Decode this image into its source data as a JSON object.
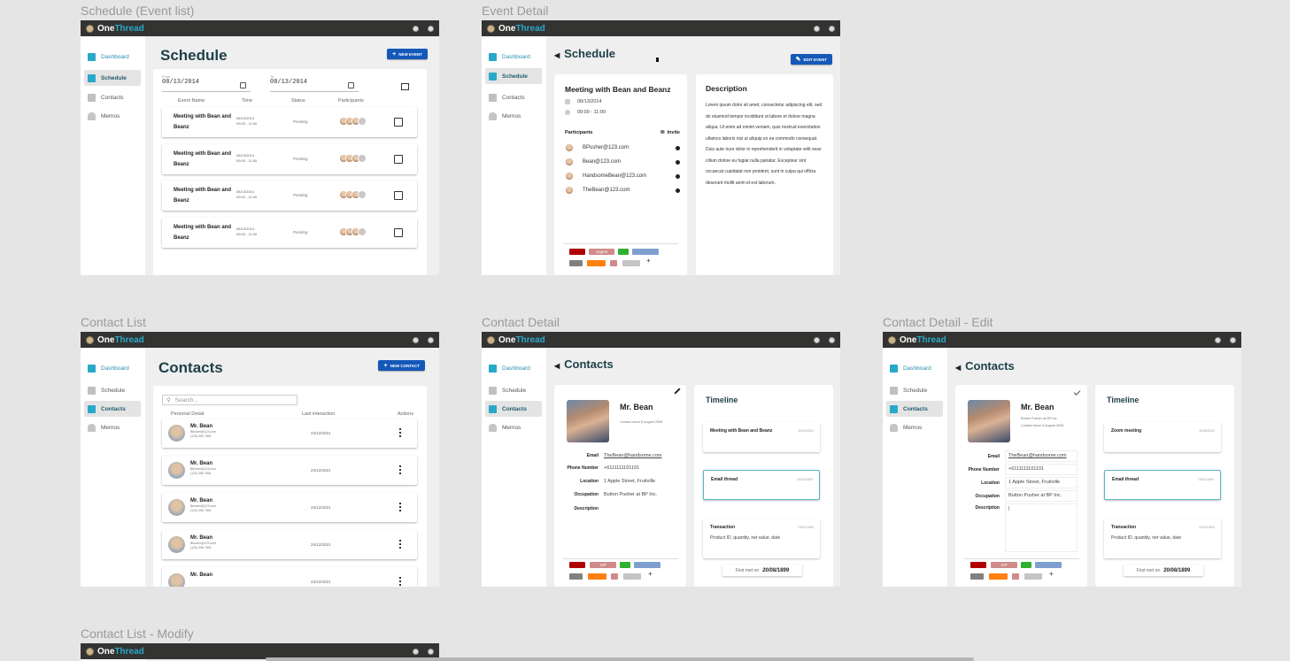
{
  "app": {
    "brand_part1": "One",
    "brand_part2": "Thread"
  },
  "sidebar": {
    "items": [
      {
        "label": "Dashboard",
        "icon": "dashboard-icon"
      },
      {
        "label": "Schedule",
        "icon": "calendar-icon"
      },
      {
        "label": "Contacts",
        "icon": "contact-card-icon"
      },
      {
        "label": "Memos",
        "icon": "bell-icon"
      }
    ]
  },
  "frames": {
    "schedule": {
      "label": "Schedule (Event list)",
      "title": "Schedule",
      "new_button": "NEW EVENT",
      "from_label": "From",
      "from_value": "08/13/2014",
      "to_label": "To",
      "to_value": "08/13/2014",
      "columns": [
        "Event Name",
        "Time",
        "Status",
        "Participants"
      ],
      "events": [
        {
          "name": "Meeting with Bean and Beanz",
          "date": "08/13/2014",
          "time": "09:00 - 11:00",
          "status": "Pending"
        },
        {
          "name": "Meeting with Bean and Beanz",
          "date": "08/13/2014",
          "time": "09:00 - 11:00",
          "status": "Pending"
        },
        {
          "name": "Meeting with Bean and Beanz",
          "date": "08/13/2014",
          "time": "09:00 - 11:00",
          "status": "Pending"
        },
        {
          "name": "Meeting with Bean and Beanz",
          "date": "08/13/2014",
          "time": "09:00 - 11:00",
          "status": "Pending"
        }
      ]
    },
    "event_detail": {
      "label": "Event Detail",
      "back_title": "Schedule",
      "edit_button": "EDIT EVENT",
      "event_title": "Meeting with Bean and Beanz",
      "date": "08/13/2014",
      "time": "09:00 - 11:00",
      "participants_label": "Participants",
      "invite_label": "Invite",
      "participants": [
        "BPusher@123.com",
        "Bean@123.com",
        "HandsomeBean@123.com",
        "TheBean@123.com"
      ],
      "description_title": "Description",
      "description": "Lorem ipsum dolor sit amet, consectetur adipiscing elit, sed do eiusmod tempor incididunt ut labore et dolore magna aliqua. Ut enim ad minim veniam, quis nostrud exercitation ullamco laboris nisi ut aliquip ex ea commodo consequat. Duis aute irure dolor in reprehenderit in voluptate velit esse cillum dolore eu fugiat nulla pariatur. Excepteur sint occaecat cupidatat non proident, sunt in culpa qui officia deserunt mollit anim id est laborum.",
      "tags": [
        {
          "label": "",
          "color": "#b00000"
        },
        {
          "label": "Urgent",
          "color": "#d08a8a"
        },
        {
          "label": "",
          "color": "#30b030"
        },
        {
          "label": "",
          "color": "#7fa0cf"
        },
        {
          "label": "",
          "color": "#808080"
        },
        {
          "label": "",
          "color": "#ff8010"
        },
        {
          "label": "",
          "color": "#d08a8a"
        },
        {
          "label": "",
          "color": "#c4c4c4"
        }
      ],
      "add_tag": "+"
    },
    "contact_list": {
      "label": "Contact List",
      "title": "Contacts",
      "new_button": "NEW CONTACT",
      "search_placeholder": "Search...",
      "columns": [
        "Personal Detail",
        "Last interaction",
        "Actions"
      ],
      "contacts": [
        {
          "name": "Mr. Bean",
          "email": "Bfusher@123.com",
          "phone": "(123) 456 7891",
          "last": "24/12/2021"
        },
        {
          "name": "Mr. Bean",
          "email": "Bfusher@123.com",
          "phone": "(123) 456 7891",
          "last": "24/12/2021"
        },
        {
          "name": "Mr. Bean",
          "email": "Bfusher@123.com",
          "phone": "(123) 456 7891",
          "last": "24/12/2021"
        },
        {
          "name": "Mr. Bean",
          "email": "Bfusher@123.com",
          "phone": "(123) 456 7891",
          "last": "24/12/2021"
        },
        {
          "name": "Mr. Bean",
          "email": "",
          "phone": "",
          "last": "24/12/2021"
        }
      ]
    },
    "contact_detail": {
      "label": "Contact Detail",
      "back_title": "Contacts",
      "name": "Mr. Bean",
      "since": "Contact since 8 August 2008",
      "fields": [
        {
          "label": "Email",
          "value": "TheBean@handsome.com"
        },
        {
          "label": "Phone Number",
          "value": "+6111111101101"
        },
        {
          "label": "Location",
          "value": "1 Apple Street, Fruitville"
        },
        {
          "label": "Occupation",
          "value": "Button Pusher at BP Inc."
        },
        {
          "label": "Description",
          "value": ""
        }
      ],
      "tags": [
        {
          "label": "",
          "color": "#b00000"
        },
        {
          "label": "VIP",
          "color": "#d08a8a"
        },
        {
          "label": "",
          "color": "#30b030"
        },
        {
          "label": "",
          "color": "#7fa0cf"
        },
        {
          "label": "",
          "color": "#808080"
        },
        {
          "label": "",
          "color": "#ff8010"
        },
        {
          "label": "",
          "color": "#d08a8a"
        },
        {
          "label": "",
          "color": "#c4c4c4"
        }
      ],
      "add_tag": "+",
      "timeline_title": "Timeline",
      "timeline": [
        {
          "title": "Meeting with Bean and Beanz",
          "date": "20/10/2021",
          "body": ""
        },
        {
          "title": "Email thread",
          "date": "01/01/1900",
          "body": ""
        },
        {
          "title": "Transaction",
          "date": "01/01/1900",
          "body": "Product ID, quantity, net value, date"
        }
      ],
      "first_met_label": "First met on",
      "first_met_value": "20/08/1899"
    },
    "contact_edit": {
      "label": "Contact Detail - Edit",
      "back_title": "Contacts",
      "name": "Mr. Bean",
      "occupation_line": "Button Pusher at BP Inc.",
      "since": "Contact since 8 August 2008",
      "fields": [
        {
          "label": "Email",
          "value": "TheBean@handsome.com"
        },
        {
          "label": "Phone Number",
          "value": "+6111111101101"
        },
        {
          "label": "Location",
          "value": "1 Apple Street, Fruitville"
        },
        {
          "label": "Occupation",
          "value": "Button Pusher at BP Inc."
        },
        {
          "label": "Description",
          "value": "|"
        }
      ],
      "timeline_title": "Timeline",
      "timeline": [
        {
          "title": "Zoom meeting",
          "date": "20/10/2021",
          "body": ""
        },
        {
          "title": "Email thread",
          "date": "01/01/1900",
          "body": ""
        },
        {
          "title": "Transaction",
          "date": "01/01/1900",
          "body": "Product ID, quantity, net value, date"
        }
      ],
      "first_met_label": "First met on",
      "first_met_value": "20/08/1899"
    },
    "contact_modify": {
      "label": "Contact List - Modify"
    }
  }
}
